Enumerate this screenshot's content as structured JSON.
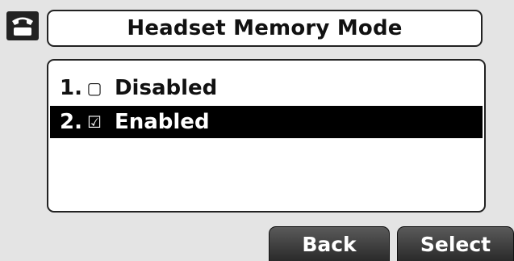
{
  "icons": {
    "status": "phone-handset-icon"
  },
  "header": {
    "title": "Headset Memory Mode"
  },
  "menu": {
    "items": [
      {
        "number": "1.",
        "state": "unchecked",
        "glyph": "▢",
        "label": "Disabled",
        "selected": false
      },
      {
        "number": "2.",
        "state": "checked",
        "glyph": "☑",
        "label": "Enabled",
        "selected": true
      }
    ]
  },
  "softkeys": {
    "back_label": "Back",
    "select_label": "Select"
  }
}
